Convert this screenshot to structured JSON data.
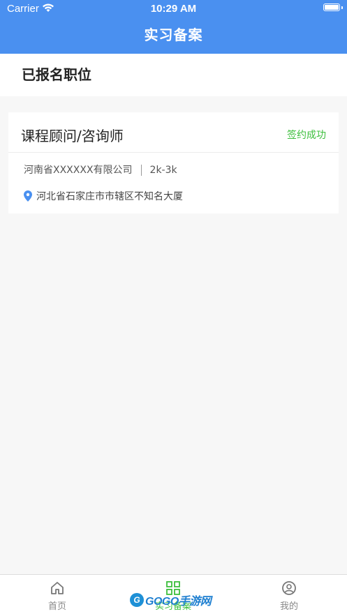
{
  "status_bar": {
    "carrier": "Carrier",
    "time": "10:29 AM"
  },
  "nav": {
    "title": "实习备案"
  },
  "section": {
    "title": "已报名职位"
  },
  "job": {
    "title": "课程顾问/咨询师",
    "status": "签约成功",
    "company": "河南省XXXXXX有限公司",
    "salary": "2k-3k",
    "location": "河北省石家庄市市辖区不知名大厦"
  },
  "tabbar": {
    "items": [
      {
        "label": "首页",
        "icon": "home-icon"
      },
      {
        "label": "实习备案",
        "icon": "qr-grid-icon"
      },
      {
        "label": "我的",
        "icon": "user-circle-icon"
      }
    ]
  },
  "watermark": {
    "badge": "G",
    "text": "GOGO手游网"
  },
  "colors": {
    "primary": "#4a90f0",
    "success": "#3cbf3c"
  }
}
